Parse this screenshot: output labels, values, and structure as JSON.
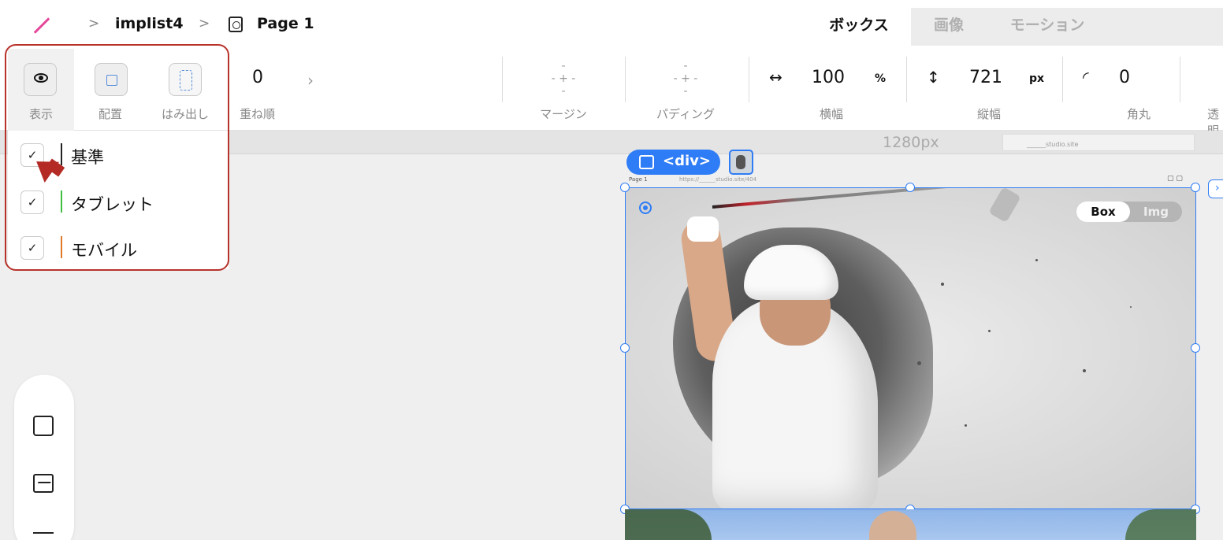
{
  "breadcrumb": {
    "project": "implist4",
    "page": "Page 1",
    "separator": ">"
  },
  "tabs": [
    {
      "label": "ボックス",
      "active": true
    },
    {
      "label": "画像",
      "active": false
    },
    {
      "label": "モーション",
      "active": false
    }
  ],
  "toolbar": {
    "visibility_label": "表示",
    "placement_label": "配置",
    "overflow_label": "はみ出し",
    "z_order": {
      "label": "重ね順",
      "value": "0"
    },
    "margin": {
      "label": "マージン",
      "value": "- + -"
    },
    "padding": {
      "label": "パディング",
      "value": "- + -"
    },
    "width": {
      "label": "横幅",
      "value": "100",
      "unit": "%"
    },
    "height": {
      "label": "縦幅",
      "value": "721",
      "unit": "px"
    },
    "radius": {
      "label": "角丸",
      "value": "0"
    },
    "opacity_label": "透明"
  },
  "visibility_dropdown": {
    "items": [
      {
        "label": "基準",
        "checked": true,
        "color": "#222222"
      },
      {
        "label": "タブレット",
        "checked": true,
        "color": "#3fbf3f"
      },
      {
        "label": "モバイル",
        "checked": true,
        "color": "#e07a2a"
      }
    ],
    "check_glyph": "✓"
  },
  "ruler": {
    "width_text": "1280px",
    "site_text": "______studio.site"
  },
  "canvas": {
    "element_tag": "<div>",
    "page_label": "Page 1",
    "url_label": "https://______studio.site/404",
    "mode_toggle": {
      "on": "Box",
      "off": "Img"
    }
  },
  "colors": {
    "accent": "#2f7df6",
    "highlight": "#b7322a",
    "logo": "#e6489a"
  }
}
